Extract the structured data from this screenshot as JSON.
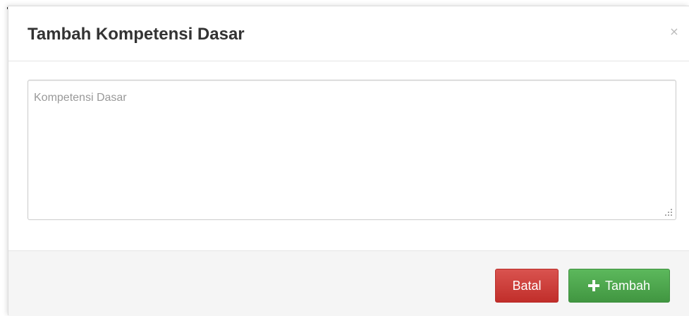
{
  "modal": {
    "title": "Tambah Kompetensi Dasar",
    "close_icon": "close-icon",
    "close_glyph": "×"
  },
  "form": {
    "kompetensi_dasar": {
      "placeholder": "Kompetensi Dasar",
      "value": ""
    }
  },
  "footer": {
    "cancel_label": "Batal",
    "submit_label": "Tambah",
    "submit_icon": "plus-icon"
  },
  "colors": {
    "cancel_button": "#d9534f",
    "submit_button": "#5cb85c",
    "footer_background": "#f5f5f5",
    "title_text": "#333333"
  }
}
